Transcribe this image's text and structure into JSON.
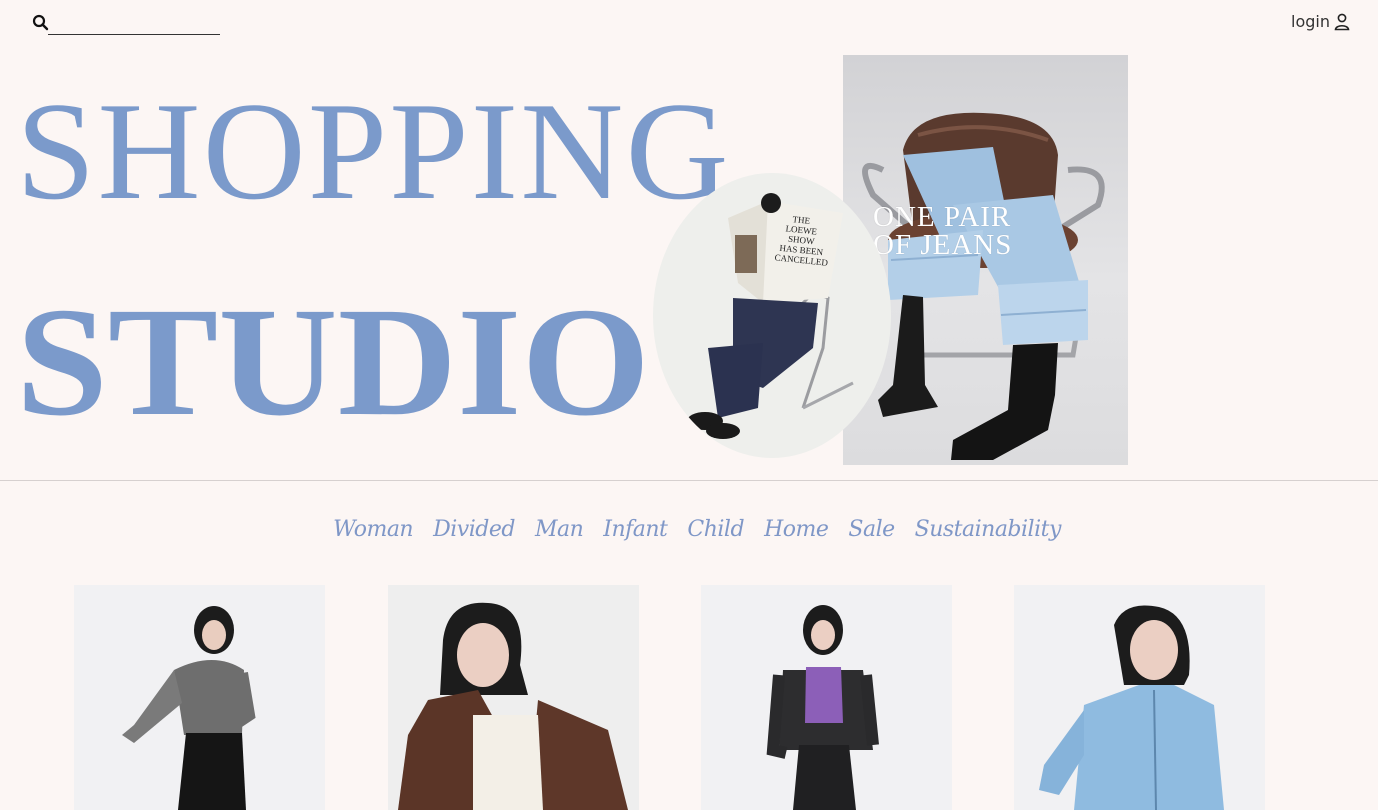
{
  "search": {
    "placeholder": "",
    "value": ""
  },
  "header": {
    "login_label": "login"
  },
  "hero": {
    "title_line_1": "SHOPPING",
    "title_line_2": "STUDIO",
    "caption_line_1": "ONE PAIR",
    "caption_line_2": "OF JEANS",
    "newspaper_headline": "THE LOEWE SHOW HAS BEEN CANCELLED"
  },
  "nav": {
    "items": [
      "Woman",
      "Divided",
      "Man",
      "Infant",
      "Child",
      "Home",
      "Sale",
      "Sustainability"
    ]
  },
  "colors": {
    "background": "#fcf6f4",
    "accent": "#7b9acb",
    "nav": "#7f97c7"
  },
  "icons": {
    "search": "search-icon",
    "user": "user-icon"
  }
}
